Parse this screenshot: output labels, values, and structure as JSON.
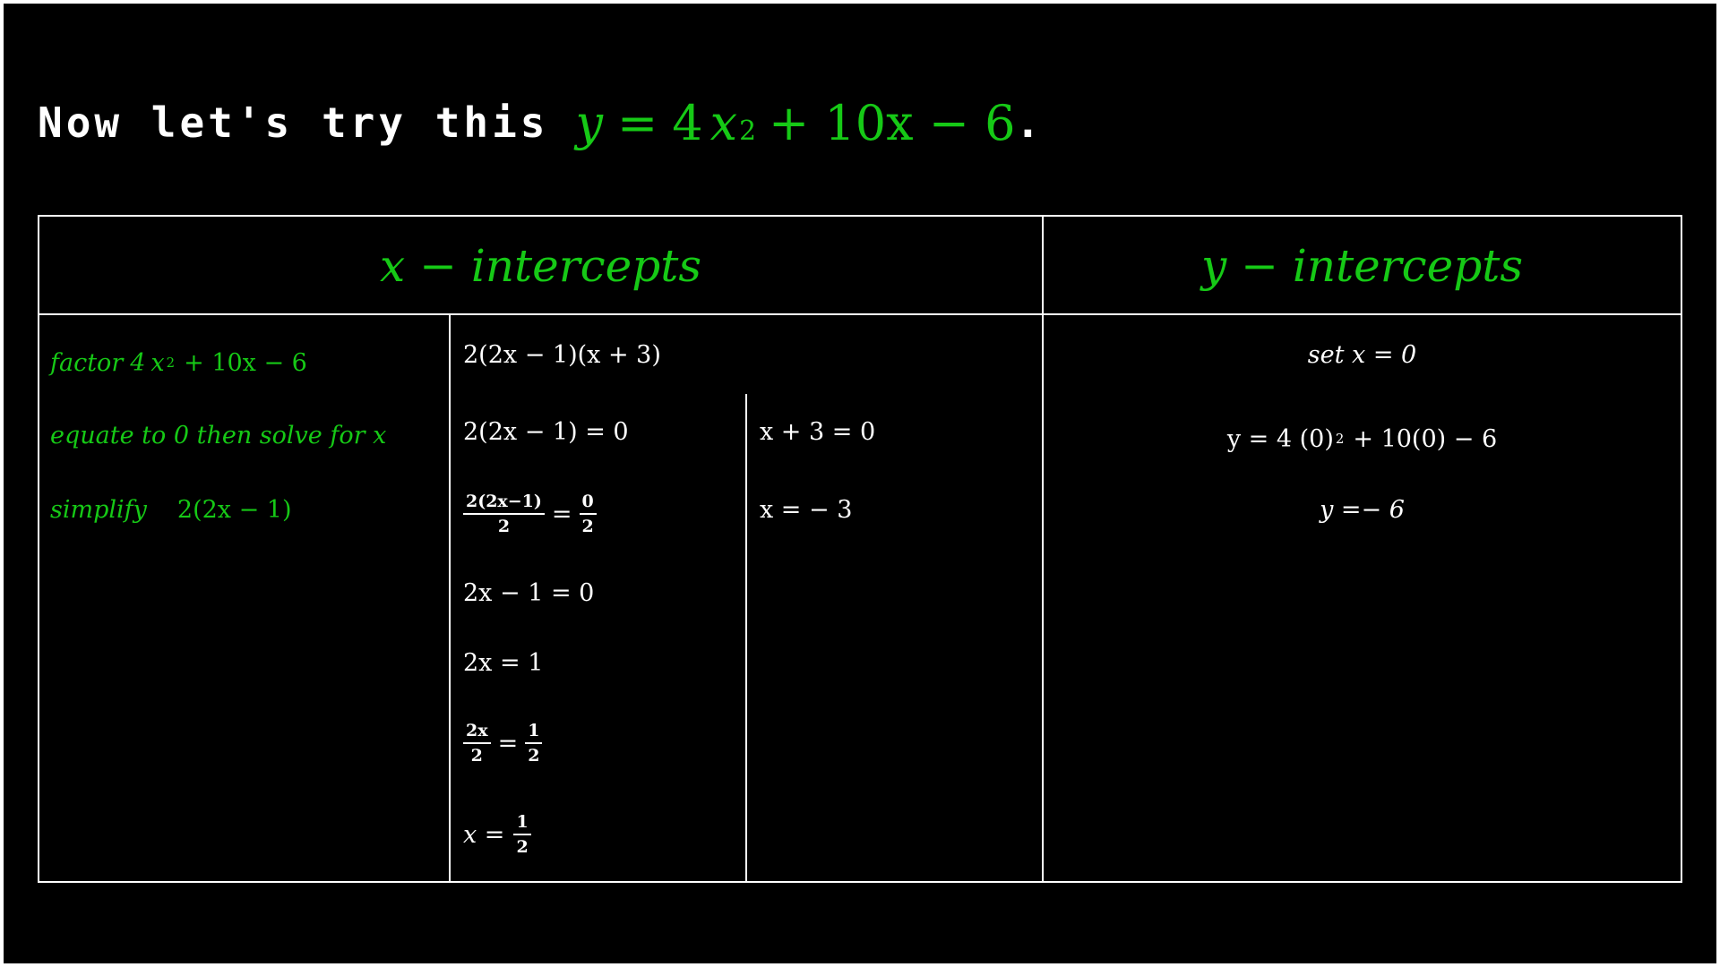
{
  "title": {
    "lead": "Now let's try this",
    "eq_y": "y",
    "eq_eq": "=",
    "eq_coef": "4",
    "eq_x": "x",
    "eq_exp": "2",
    "eq_rest": "+ 10x − 6",
    "end": "."
  },
  "table": {
    "x_header": "x − intercepts",
    "y_header": "y − intercepts",
    "steps": {
      "factor_label": "factor",
      "factor_coef": "4",
      "factor_x": "x",
      "factor_exp": "2",
      "factor_rest": "+ 10x − 6",
      "equate_label": "equate to 0 then solve for x",
      "simplify_label": "simplify",
      "simplify_expr": "2(2x − 1)"
    },
    "work": {
      "factored": "2(2x − 1)(x + 3)",
      "eq1": "2(2x − 1) = 0",
      "eq2": "x + 3  =  0",
      "frac1_num": "2(2x−1)",
      "frac1_den": "2",
      "frac1_eq": "=",
      "frac1_rnum": "0",
      "frac1_rden": "2",
      "res2": "x  =   − 3",
      "step_a": "2x − 1 = 0",
      "step_b": "2x = 1",
      "frac2_num": "2x",
      "frac2_den": "2",
      "frac2_eq": "=",
      "frac2_rnum": "1",
      "frac2_rden": "2",
      "res1_lhs": "x =",
      "res1_num": "1",
      "res1_den": "2"
    },
    "y_work": {
      "set": "set x = 0",
      "sub_lhs": "y  = 4 (0)",
      "sub_exp": "2",
      "sub_rest": "+ 10(0) − 6",
      "result": "y =− 6"
    }
  },
  "colors": {
    "background": "#000000",
    "text": "#ffffff",
    "accent": "#16c916",
    "grid": "#ffffff"
  }
}
